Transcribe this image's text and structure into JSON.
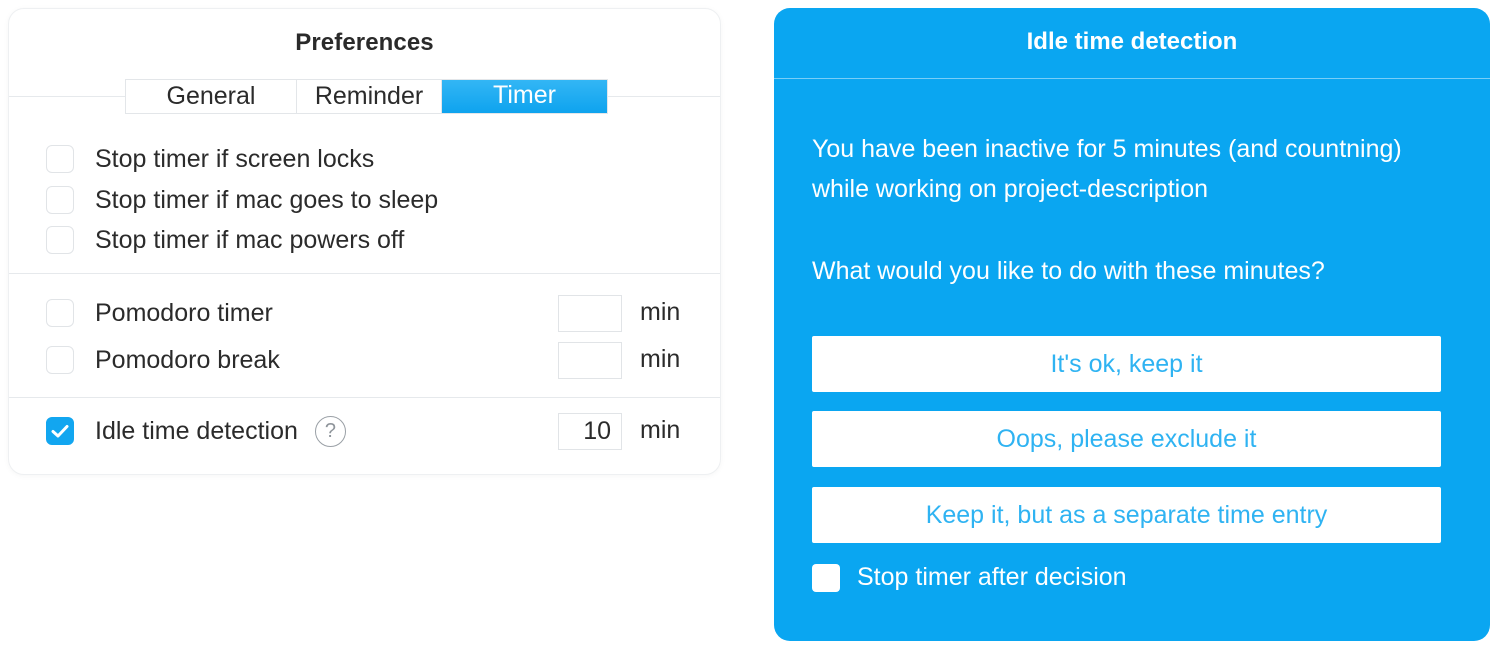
{
  "preferences": {
    "title": "Preferences",
    "tabs": [
      {
        "label": "General",
        "active": false
      },
      {
        "label": "Reminder",
        "active": false
      },
      {
        "label": "Timer",
        "active": true
      }
    ],
    "stop_options": [
      {
        "label": "Stop timer if screen locks",
        "checked": false
      },
      {
        "label": "Stop timer if mac goes to sleep",
        "checked": false
      },
      {
        "label": "Stop timer if mac powers off",
        "checked": false
      }
    ],
    "pomodoro_timer": {
      "label": "Pomodoro timer",
      "checked": false,
      "value": "",
      "unit": "min"
    },
    "pomodoro_break": {
      "label": "Pomodoro break",
      "checked": false,
      "value": "",
      "unit": "min"
    },
    "idle_detection": {
      "label": "Idle time detection",
      "checked": true,
      "value": "10",
      "unit": "min",
      "help_icon": "question-circle-icon"
    }
  },
  "idle_dialog": {
    "title": "Idle time detection",
    "message": "You have been inactive for 5 minutes (and countning) while working on project-description",
    "question": "What would you like to do with these minutes?",
    "buttons": {
      "keep": "It's ok, keep it",
      "exclude": "Oops, please exclude it",
      "separate": "Keep it, but as a separate time entry"
    },
    "stop_after_decision": {
      "label": "Stop timer after decision",
      "checked": false
    }
  },
  "colors": {
    "accent": "#0aa6f1",
    "button_text": "#2fb3f2",
    "text": "#2b2b2b",
    "border": "#e1e4e7"
  }
}
